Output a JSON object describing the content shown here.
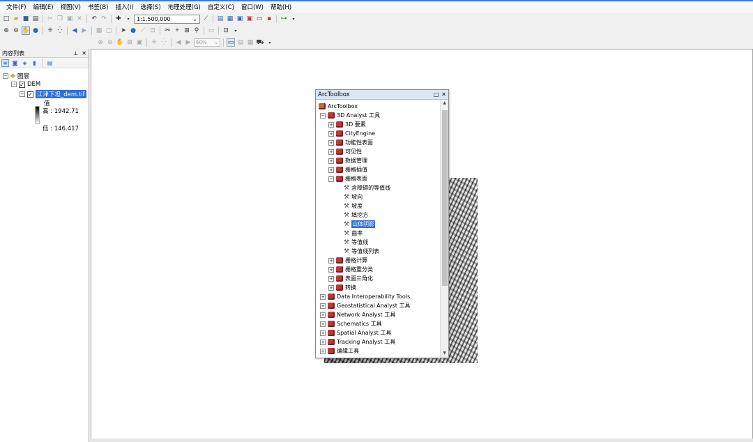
{
  "menu": [
    "文件(F)",
    "编辑(E)",
    "视图(V)",
    "书签(B)",
    "插入(I)",
    "选择(S)",
    "地理处理(G)",
    "自定义(C)",
    "窗口(W)",
    "帮助(H)"
  ],
  "toolbar": {
    "scale": "1:1,500,000",
    "zoom": "60%"
  },
  "toc": {
    "title": "内容列表",
    "layers_label": "图层",
    "group_label": "DEM",
    "raster_label": "江津下坦_dem.tif",
    "value_label": "值",
    "high_label": "高 : 1942.71",
    "low_label": "低 : 146.417"
  },
  "toolbox": {
    "title": "ArcToolbox",
    "root": "ArcToolbox",
    "items": {
      "i0": "3D Analyst 工具",
      "i1": "3D 要素",
      "i2": "CityEngine",
      "i3": "功能性表面",
      "i4": "可见性",
      "i5": "数据管理",
      "i6": "栅格插值",
      "i7": "栅格表面",
      "t0": "含障碍的等值线",
      "t1": "坡向",
      "t2": "坡度",
      "t3": "填挖方",
      "t4": "山体阴影",
      "t5": "曲率",
      "t6": "等值线",
      "t7": "等值线列表",
      "i8": "栅格计算",
      "i9": "栅格重分类",
      "i10": "表面三角化",
      "i11": "转换",
      "r0": "Data Interoperability Tools",
      "r1": "Geostatistical Analyst 工具",
      "r2": "Network Analyst 工具",
      "r3": "Schematics 工具",
      "r4": "Spatial Analyst 工具",
      "r5": "Tracking Analyst 工具",
      "r6": "编辑工具"
    }
  }
}
